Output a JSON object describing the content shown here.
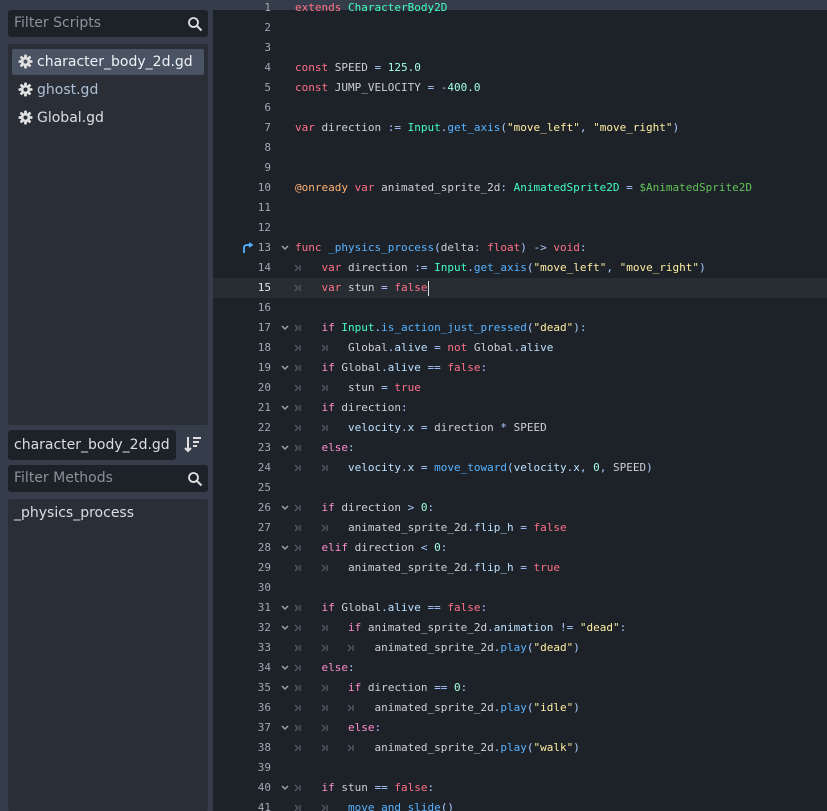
{
  "script_panel": {
    "filter_placeholder": "Filter Scripts",
    "scripts": [
      {
        "name": "character_body_2d.gd",
        "selected": true
      },
      {
        "name": "ghost.gd",
        "modified": true
      },
      {
        "name": "Global.gd"
      }
    ]
  },
  "method_panel": {
    "current_script": "character_body_2d.gd",
    "filter_placeholder": "Filter Methods",
    "methods": [
      "_physics_process"
    ]
  },
  "editor": {
    "current_line": 15,
    "lines": [
      {
        "n": "1",
        "tokens": [
          [
            "kw",
            "extends"
          ],
          [
            "t",
            " "
          ],
          [
            "bi",
            "CharacterBody2D"
          ]
        ]
      },
      {
        "n": "2",
        "tokens": []
      },
      {
        "n": "3",
        "tokens": []
      },
      {
        "n": "4",
        "tokens": [
          [
            "kw",
            "const"
          ],
          [
            "t",
            " SPEED "
          ],
          [
            "sy",
            "="
          ],
          [
            "t",
            " "
          ],
          [
            "nm",
            "125.0"
          ]
        ]
      },
      {
        "n": "5",
        "tokens": [
          [
            "kw",
            "const"
          ],
          [
            "t",
            " JUMP_VELOCITY "
          ],
          [
            "sy",
            "="
          ],
          [
            "t",
            " "
          ],
          [
            "sy",
            "-"
          ],
          [
            "nm",
            "400.0"
          ]
        ]
      },
      {
        "n": "6",
        "tokens": []
      },
      {
        "n": "7",
        "tokens": [
          [
            "kw",
            "var"
          ],
          [
            "t",
            " direction "
          ],
          [
            "sy",
            ":="
          ],
          [
            "t",
            " "
          ],
          [
            "bi",
            "Input"
          ],
          [
            "sy",
            "."
          ],
          [
            "fn",
            "get_axis"
          ],
          [
            "sy",
            "("
          ],
          [
            "st",
            "\"move_left\""
          ],
          [
            "sy",
            ","
          ],
          [
            "t",
            " "
          ],
          [
            "st",
            "\"move_right\""
          ],
          [
            "sy",
            ")"
          ]
        ]
      },
      {
        "n": "8",
        "tokens": []
      },
      {
        "n": "9",
        "tokens": []
      },
      {
        "n": "10",
        "tokens": [
          [
            "an",
            "@onready"
          ],
          [
            "t",
            " "
          ],
          [
            "kw",
            "var"
          ],
          [
            "t",
            " animated_sprite_2d"
          ],
          [
            "sy",
            ":"
          ],
          [
            "t",
            " "
          ],
          [
            "bi",
            "AnimatedSprite2D"
          ],
          [
            "t",
            " "
          ],
          [
            "sy",
            "="
          ],
          [
            "t",
            " "
          ],
          [
            "nd",
            "$AnimatedSprite2D"
          ]
        ]
      },
      {
        "n": "11",
        "tokens": []
      },
      {
        "n": "12",
        "tokens": []
      },
      {
        "n": "13",
        "fold": true,
        "bookmark": true,
        "tokens": [
          [
            "kw",
            "func"
          ],
          [
            "t",
            " "
          ],
          [
            "fn",
            "_physics_process"
          ],
          [
            "sy",
            "("
          ],
          [
            "t",
            "delta"
          ],
          [
            "sy",
            ":"
          ],
          [
            "t",
            " "
          ],
          [
            "kw",
            "float"
          ],
          [
            "sy",
            ")"
          ],
          [
            "t",
            " "
          ],
          [
            "sy",
            "->"
          ],
          [
            "t",
            " "
          ],
          [
            "kw",
            "void"
          ],
          [
            "sy",
            ":"
          ]
        ]
      },
      {
        "n": "14",
        "indent": 1,
        "tokens": [
          [
            "kw",
            "var"
          ],
          [
            "t",
            " direction "
          ],
          [
            "sy",
            ":="
          ],
          [
            "t",
            " "
          ],
          [
            "bi",
            "Input"
          ],
          [
            "sy",
            "."
          ],
          [
            "fn",
            "get_axis"
          ],
          [
            "sy",
            "("
          ],
          [
            "st",
            "\"move_left\""
          ],
          [
            "sy",
            ","
          ],
          [
            "t",
            " "
          ],
          [
            "st",
            "\"move_right\""
          ],
          [
            "sy",
            ")"
          ]
        ]
      },
      {
        "n": "15",
        "indent": 1,
        "tokens": [
          [
            "kw",
            "var"
          ],
          [
            "t",
            " stun "
          ],
          [
            "sy",
            "="
          ],
          [
            "t",
            " "
          ],
          [
            "kw",
            "false"
          ]
        ]
      },
      {
        "n": "16",
        "tokens": []
      },
      {
        "n": "17",
        "fold": true,
        "indent": 1,
        "tokens": [
          [
            "cf",
            "if"
          ],
          [
            "t",
            " "
          ],
          [
            "bi",
            "Input"
          ],
          [
            "sy",
            "."
          ],
          [
            "fn",
            "is_action_just_pressed"
          ],
          [
            "sy",
            "("
          ],
          [
            "st",
            "\"dead\""
          ],
          [
            "sy",
            "):"
          ]
        ]
      },
      {
        "n": "18",
        "indent": 2,
        "tokens": [
          [
            "t",
            "Global"
          ],
          [
            "sy",
            "."
          ],
          [
            "mb",
            "alive"
          ],
          [
            "t",
            " "
          ],
          [
            "sy",
            "="
          ],
          [
            "t",
            " "
          ],
          [
            "kw",
            "not"
          ],
          [
            "t",
            " Global"
          ],
          [
            "sy",
            "."
          ],
          [
            "mb",
            "alive"
          ]
        ]
      },
      {
        "n": "19",
        "fold": true,
        "indent": 1,
        "tokens": [
          [
            "cf",
            "if"
          ],
          [
            "t",
            " Global"
          ],
          [
            "sy",
            "."
          ],
          [
            "mb",
            "alive"
          ],
          [
            "t",
            " "
          ],
          [
            "sy",
            "=="
          ],
          [
            "t",
            " "
          ],
          [
            "kw",
            "false"
          ],
          [
            "sy",
            ":"
          ]
        ]
      },
      {
        "n": "20",
        "indent": 2,
        "tokens": [
          [
            "t",
            "stun "
          ],
          [
            "sy",
            "="
          ],
          [
            "t",
            " "
          ],
          [
            "kw",
            "true"
          ]
        ]
      },
      {
        "n": "21",
        "fold": true,
        "indent": 1,
        "tokens": [
          [
            "cf",
            "if"
          ],
          [
            "t",
            " direction"
          ],
          [
            "sy",
            ":"
          ]
        ]
      },
      {
        "n": "22",
        "indent": 2,
        "tokens": [
          [
            "mb",
            "velocity"
          ],
          [
            "sy",
            "."
          ],
          [
            "mb",
            "x"
          ],
          [
            "t",
            " "
          ],
          [
            "sy",
            "="
          ],
          [
            "t",
            " direction "
          ],
          [
            "sy",
            "*"
          ],
          [
            "t",
            " SPEED"
          ]
        ]
      },
      {
        "n": "23",
        "fold": true,
        "indent": 1,
        "tokens": [
          [
            "cf",
            "else"
          ],
          [
            "sy",
            ":"
          ]
        ]
      },
      {
        "n": "24",
        "indent": 2,
        "tokens": [
          [
            "mb",
            "velocity"
          ],
          [
            "sy",
            "."
          ],
          [
            "mb",
            "x"
          ],
          [
            "t",
            " "
          ],
          [
            "sy",
            "="
          ],
          [
            "t",
            " "
          ],
          [
            "fn",
            "move_toward"
          ],
          [
            "sy",
            "("
          ],
          [
            "mb",
            "velocity"
          ],
          [
            "sy",
            "."
          ],
          [
            "mb",
            "x"
          ],
          [
            "sy",
            ","
          ],
          [
            "t",
            " "
          ],
          [
            "nm",
            "0"
          ],
          [
            "sy",
            ","
          ],
          [
            "t",
            " SPEED"
          ],
          [
            "sy",
            ")"
          ]
        ]
      },
      {
        "n": "25",
        "tokens": []
      },
      {
        "n": "26",
        "fold": true,
        "indent": 1,
        "tokens": [
          [
            "cf",
            "if"
          ],
          [
            "t",
            " direction "
          ],
          [
            "sy",
            ">"
          ],
          [
            "t",
            " "
          ],
          [
            "nm",
            "0"
          ],
          [
            "sy",
            ":"
          ]
        ]
      },
      {
        "n": "27",
        "indent": 2,
        "tokens": [
          [
            "t",
            "animated_sprite_2d"
          ],
          [
            "sy",
            "."
          ],
          [
            "mb",
            "flip_h"
          ],
          [
            "t",
            " "
          ],
          [
            "sy",
            "="
          ],
          [
            "t",
            " "
          ],
          [
            "kw",
            "false"
          ]
        ]
      },
      {
        "n": "28",
        "fold": true,
        "indent": 1,
        "tokens": [
          [
            "cf",
            "elif"
          ],
          [
            "t",
            " direction "
          ],
          [
            "sy",
            "<"
          ],
          [
            "t",
            " "
          ],
          [
            "nm",
            "0"
          ],
          [
            "sy",
            ":"
          ]
        ]
      },
      {
        "n": "29",
        "indent": 2,
        "tokens": [
          [
            "t",
            "animated_sprite_2d"
          ],
          [
            "sy",
            "."
          ],
          [
            "mb",
            "flip_h"
          ],
          [
            "t",
            " "
          ],
          [
            "sy",
            "="
          ],
          [
            "t",
            " "
          ],
          [
            "kw",
            "true"
          ]
        ]
      },
      {
        "n": "30",
        "tokens": []
      },
      {
        "n": "31",
        "fold": true,
        "indent": 1,
        "tokens": [
          [
            "cf",
            "if"
          ],
          [
            "t",
            " Global"
          ],
          [
            "sy",
            "."
          ],
          [
            "mb",
            "alive"
          ],
          [
            "t",
            " "
          ],
          [
            "sy",
            "=="
          ],
          [
            "t",
            " "
          ],
          [
            "kw",
            "false"
          ],
          [
            "sy",
            ":"
          ]
        ]
      },
      {
        "n": "32",
        "fold": true,
        "indent": 2,
        "tokens": [
          [
            "cf",
            "if"
          ],
          [
            "t",
            " animated_sprite_2d"
          ],
          [
            "sy",
            "."
          ],
          [
            "mb",
            "animation"
          ],
          [
            "t",
            " "
          ],
          [
            "sy",
            "!="
          ],
          [
            "t",
            " "
          ],
          [
            "st",
            "\"dead\""
          ],
          [
            "sy",
            ":"
          ]
        ]
      },
      {
        "n": "33",
        "indent": 3,
        "tokens": [
          [
            "t",
            "animated_sprite_2d"
          ],
          [
            "sy",
            "."
          ],
          [
            "fn",
            "play"
          ],
          [
            "sy",
            "("
          ],
          [
            "st",
            "\"dead\""
          ],
          [
            "sy",
            ")"
          ]
        ]
      },
      {
        "n": "34",
        "fold": true,
        "indent": 1,
        "tokens": [
          [
            "cf",
            "else"
          ],
          [
            "sy",
            ":"
          ]
        ]
      },
      {
        "n": "35",
        "fold": true,
        "indent": 2,
        "tokens": [
          [
            "cf",
            "if"
          ],
          [
            "t",
            " direction "
          ],
          [
            "sy",
            "=="
          ],
          [
            "t",
            " "
          ],
          [
            "nm",
            "0"
          ],
          [
            "sy",
            ":"
          ]
        ]
      },
      {
        "n": "36",
        "indent": 3,
        "tokens": [
          [
            "t",
            "animated_sprite_2d"
          ],
          [
            "sy",
            "."
          ],
          [
            "fn",
            "play"
          ],
          [
            "sy",
            "("
          ],
          [
            "st",
            "\"idle\""
          ],
          [
            "sy",
            ")"
          ]
        ]
      },
      {
        "n": "37",
        "fold": true,
        "indent": 2,
        "tokens": [
          [
            "cf",
            "else"
          ],
          [
            "sy",
            ":"
          ]
        ]
      },
      {
        "n": "38",
        "indent": 3,
        "tokens": [
          [
            "t",
            "animated_sprite_2d"
          ],
          [
            "sy",
            "."
          ],
          [
            "fn",
            "play"
          ],
          [
            "sy",
            "("
          ],
          [
            "st",
            "\"walk\""
          ],
          [
            "sy",
            ")"
          ]
        ]
      },
      {
        "n": "39",
        "tokens": []
      },
      {
        "n": "40",
        "fold": true,
        "indent": 1,
        "tokens": [
          [
            "cf",
            "if"
          ],
          [
            "t",
            " stun "
          ],
          [
            "sy",
            "=="
          ],
          [
            "t",
            " "
          ],
          [
            "kw",
            "false"
          ],
          [
            "sy",
            ":"
          ]
        ]
      },
      {
        "n": "41",
        "indent": 2,
        "tokens": [
          [
            "fn",
            "move_and_slide"
          ],
          [
            "sy",
            "()"
          ]
        ]
      }
    ]
  },
  "colors": {
    "editor_bg": "#1d2229",
    "panel_bg": "#363d4a",
    "keyword": "#ff7085",
    "control_flow": "#ff8ccc",
    "function": "#57b3ff",
    "builtin_type": "#42ffc2",
    "string": "#ffeda1",
    "number": "#a1ffe0",
    "annotation": "#ffb373",
    "node_path": "#63c259"
  }
}
